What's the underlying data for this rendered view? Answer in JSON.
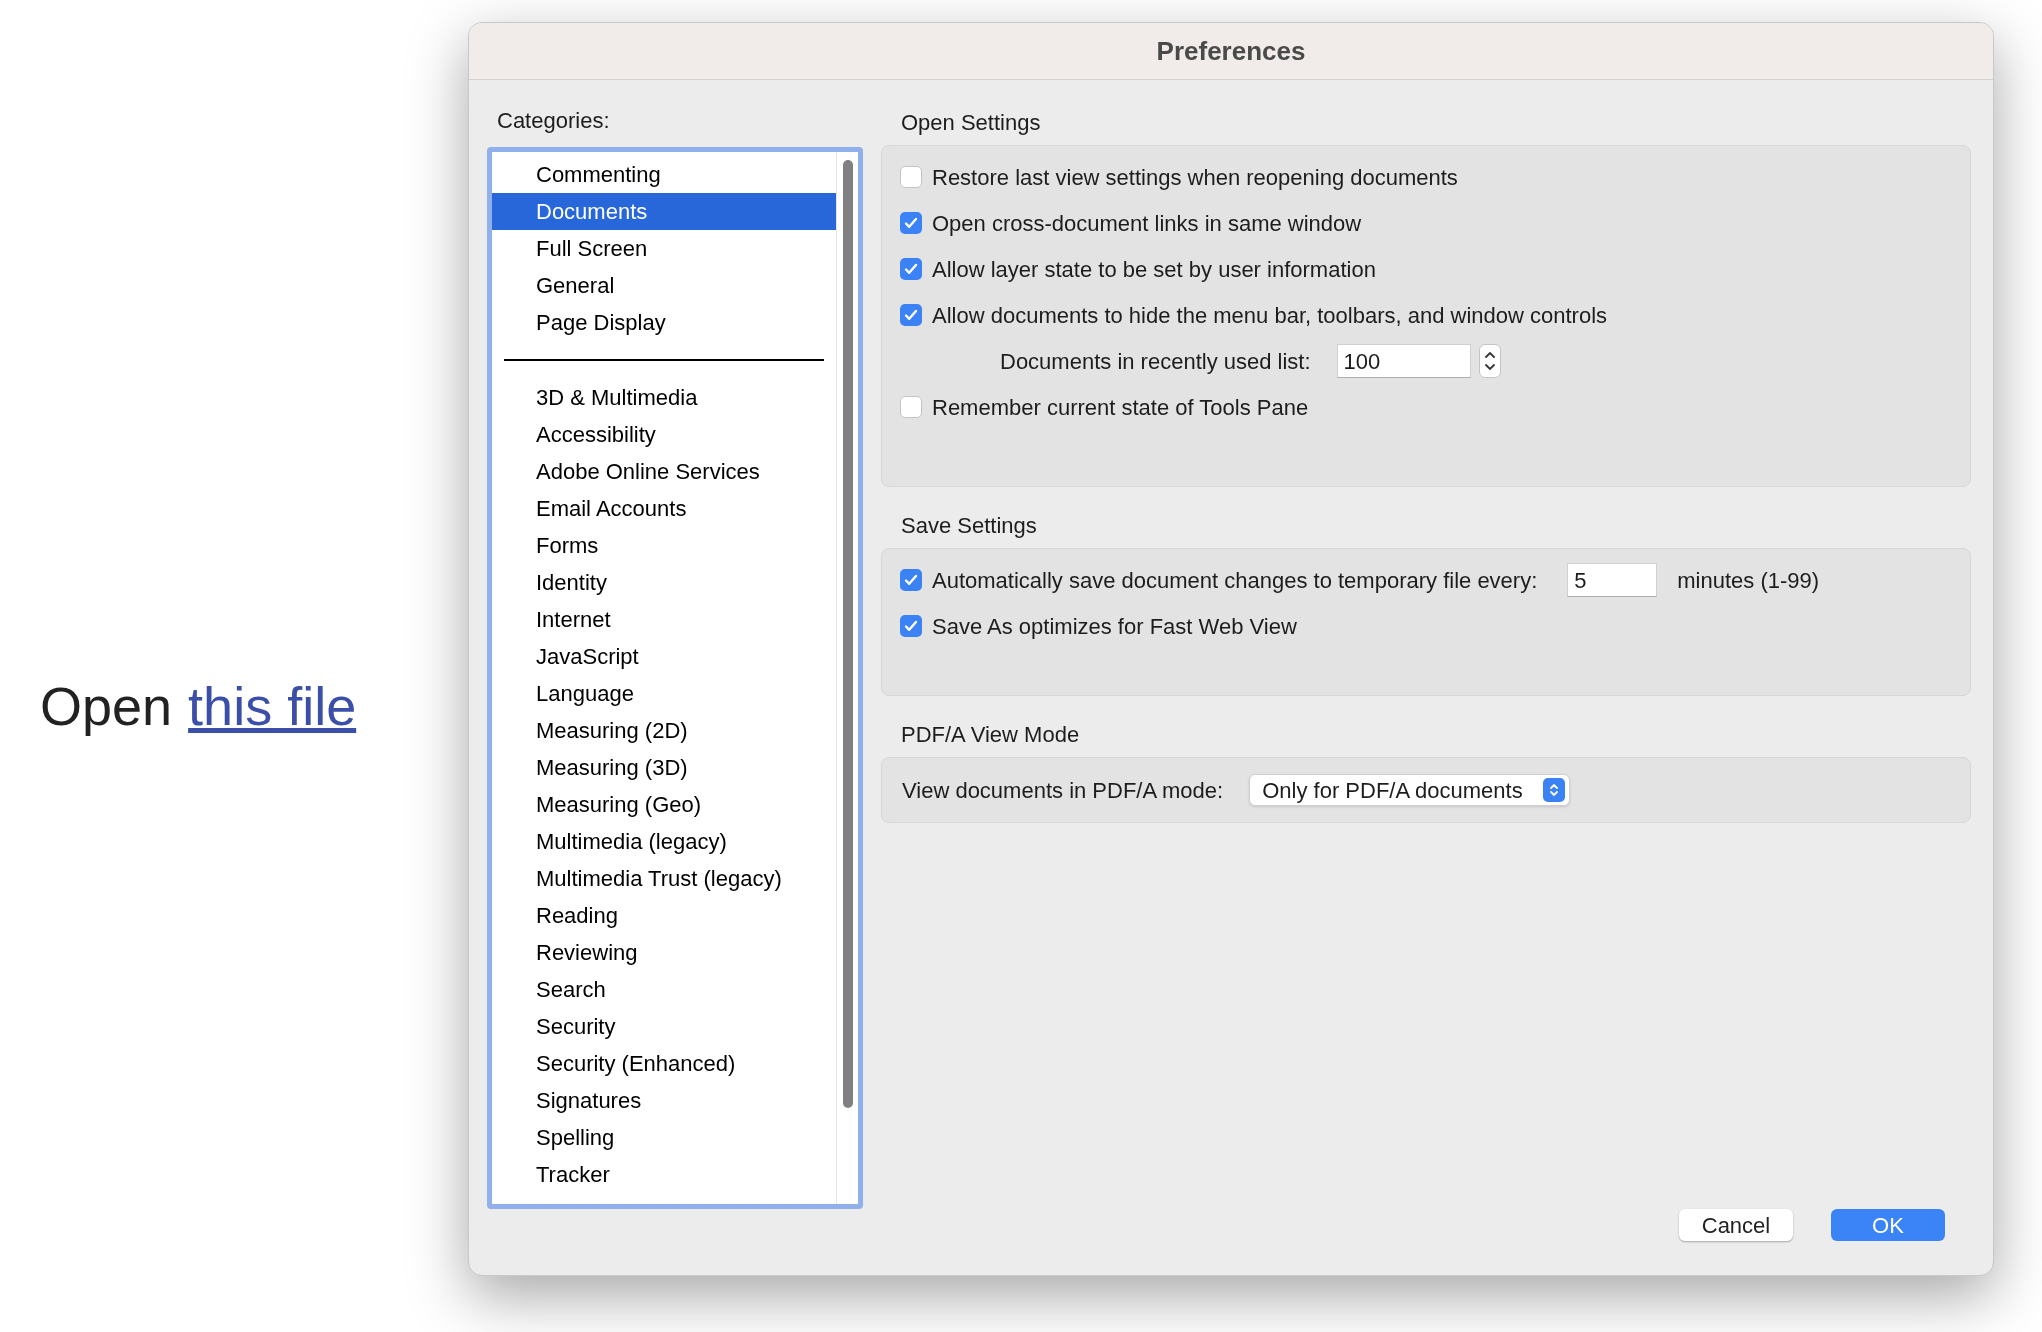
{
  "page_link": {
    "prefix": "Open",
    "link": "this file"
  },
  "window": {
    "title": "Preferences"
  },
  "categories": {
    "label": "Categories:",
    "pinned": [
      {
        "label": "Commenting",
        "selected": false
      },
      {
        "label": "Documents",
        "selected": true
      },
      {
        "label": "Full Screen",
        "selected": false
      },
      {
        "label": "General",
        "selected": false
      },
      {
        "label": "Page Display",
        "selected": false
      }
    ],
    "all": [
      {
        "label": "3D & Multimedia",
        "selected": false
      },
      {
        "label": "Accessibility",
        "selected": false
      },
      {
        "label": "Adobe Online Services",
        "selected": false
      },
      {
        "label": "Email Accounts",
        "selected": false
      },
      {
        "label": "Forms",
        "selected": false
      },
      {
        "label": "Identity",
        "selected": false
      },
      {
        "label": "Internet",
        "selected": false
      },
      {
        "label": "JavaScript",
        "selected": false
      },
      {
        "label": "Language",
        "selected": false
      },
      {
        "label": "Measuring (2D)",
        "selected": false
      },
      {
        "label": "Measuring (3D)",
        "selected": false
      },
      {
        "label": "Measuring (Geo)",
        "selected": false
      },
      {
        "label": "Multimedia (legacy)",
        "selected": false
      },
      {
        "label": "Multimedia Trust (legacy)",
        "selected": false
      },
      {
        "label": "Reading",
        "selected": false
      },
      {
        "label": "Reviewing",
        "selected": false
      },
      {
        "label": "Search",
        "selected": false
      },
      {
        "label": "Security",
        "selected": false
      },
      {
        "label": "Security (Enhanced)",
        "selected": false
      },
      {
        "label": "Signatures",
        "selected": false
      },
      {
        "label": "Spelling",
        "selected": false
      },
      {
        "label": "Tracker",
        "selected": false
      }
    ]
  },
  "sections": [
    {
      "title": "Open Settings",
      "rows": [
        {
          "kind": "checkbox",
          "label": "Restore last view settings when reopening documents",
          "checked": false
        },
        {
          "kind": "checkbox",
          "label": "Open cross-document links in same window",
          "checked": true
        },
        {
          "kind": "checkbox",
          "label": "Allow layer state to be set by user information",
          "checked": true
        },
        {
          "kind": "checkbox",
          "label": "Allow documents to hide the menu bar, toolbars, and window controls",
          "checked": true
        },
        {
          "kind": "stepper",
          "label": "Documents in recently used list:",
          "value": "100"
        },
        {
          "kind": "checkbox",
          "label": "Remember current state of Tools Pane",
          "checked": false
        }
      ]
    },
    {
      "title": "Save Settings",
      "rows": [
        {
          "kind": "checkbox_field",
          "label": "Automatically save document changes to temporary file every:",
          "checked": true,
          "value": "5",
          "suffix": "minutes (1-99)"
        },
        {
          "kind": "checkbox",
          "label": "Save As optimizes for Fast Web View",
          "checked": true
        }
      ]
    },
    {
      "title": "PDF/A View Mode",
      "rows": [
        {
          "kind": "select",
          "label": "View documents in PDF/A mode:",
          "value": "Only for PDF/A documents"
        }
      ]
    }
  ],
  "buttons": [
    {
      "label": "Cancel",
      "kind": "default"
    },
    {
      "label": "OK",
      "kind": "primary"
    }
  ]
}
